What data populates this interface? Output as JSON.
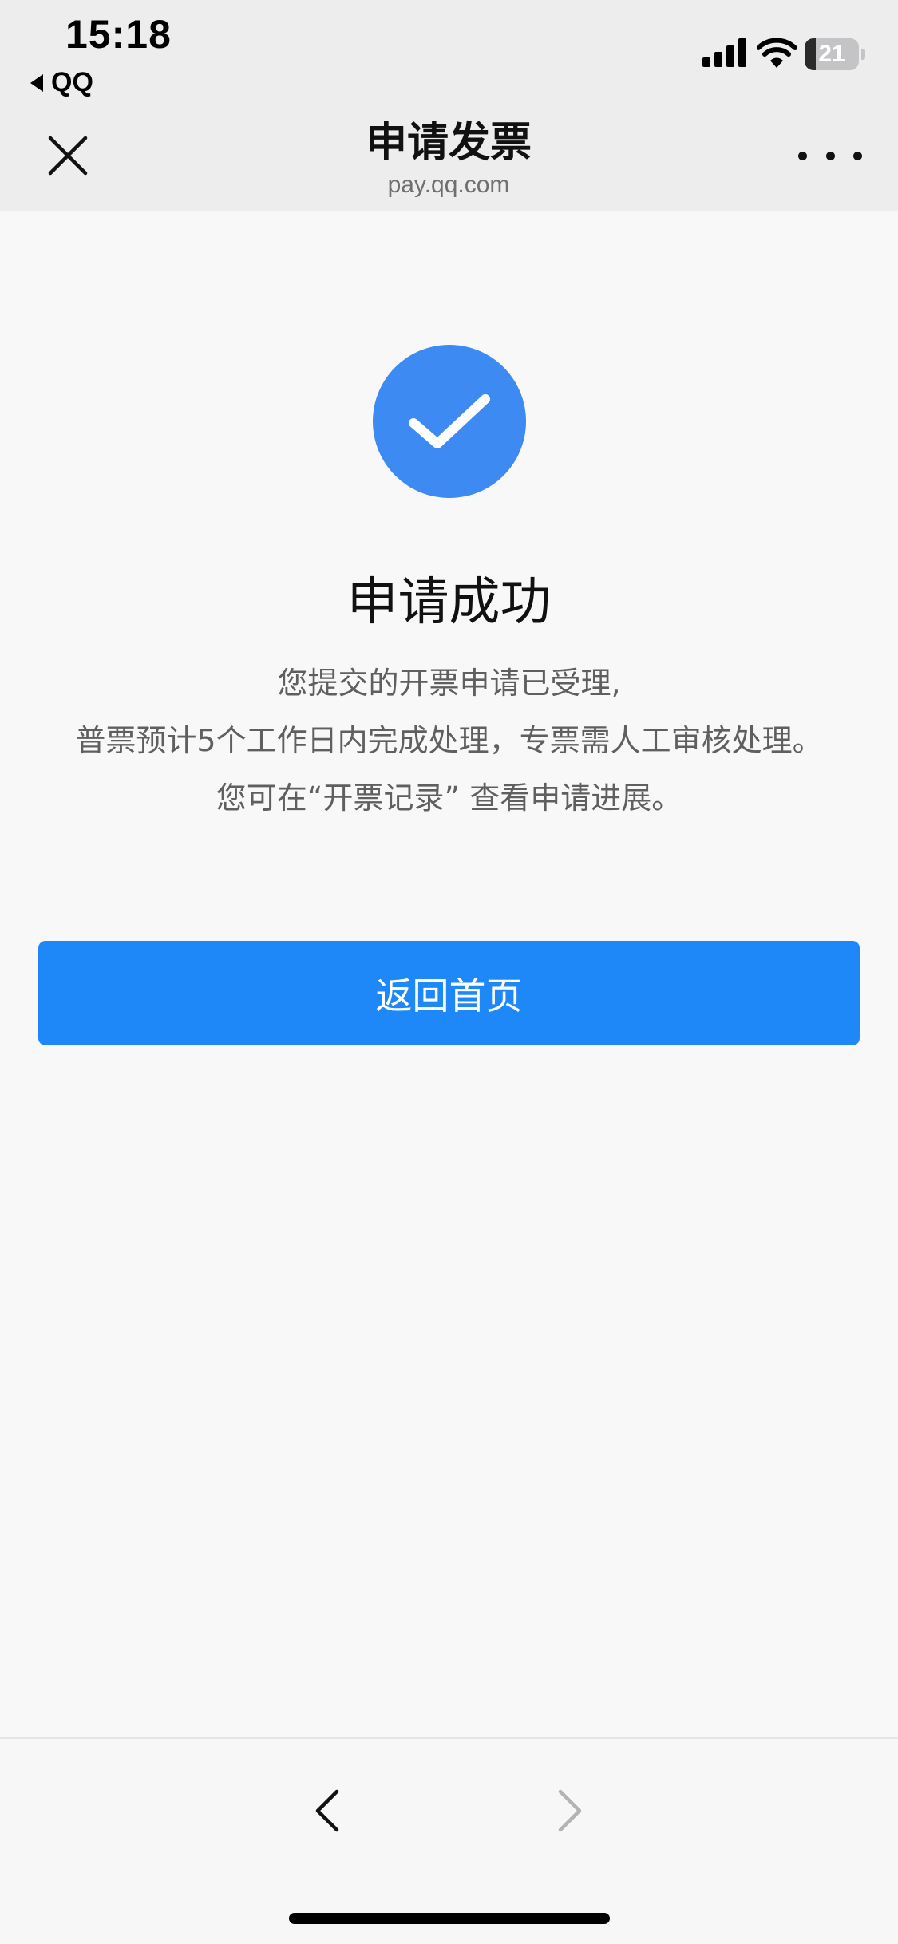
{
  "status_bar": {
    "time": "15:18",
    "back_app": "QQ",
    "battery_level": "21",
    "battery_fraction": 0.21,
    "icons": [
      "signal-icon",
      "wifi-icon",
      "battery-icon"
    ]
  },
  "header": {
    "title": "申请发票",
    "subtitle": "pay.qq.com",
    "close_icon": "close-icon",
    "more_icon": "more-icon"
  },
  "result": {
    "icon": "checkmark-icon",
    "title": "申请成功",
    "desc_line1": "您提交的开票申请已受理,",
    "desc_line2": "普票预计5个工作日内完成处理，专票需人工审核处理。",
    "desc_line3": "您可在“开票记录” 查看申请进展。"
  },
  "actions": {
    "home_button": "返回首页"
  },
  "bottom_nav": {
    "back_icon": "chevron-left-icon",
    "forward_icon": "chevron-right-icon"
  },
  "colors": {
    "accent": "#1f88f8",
    "success_circle": "#3d8bf2",
    "header_bg": "#ededed",
    "page_bg": "#f8f8f9"
  }
}
